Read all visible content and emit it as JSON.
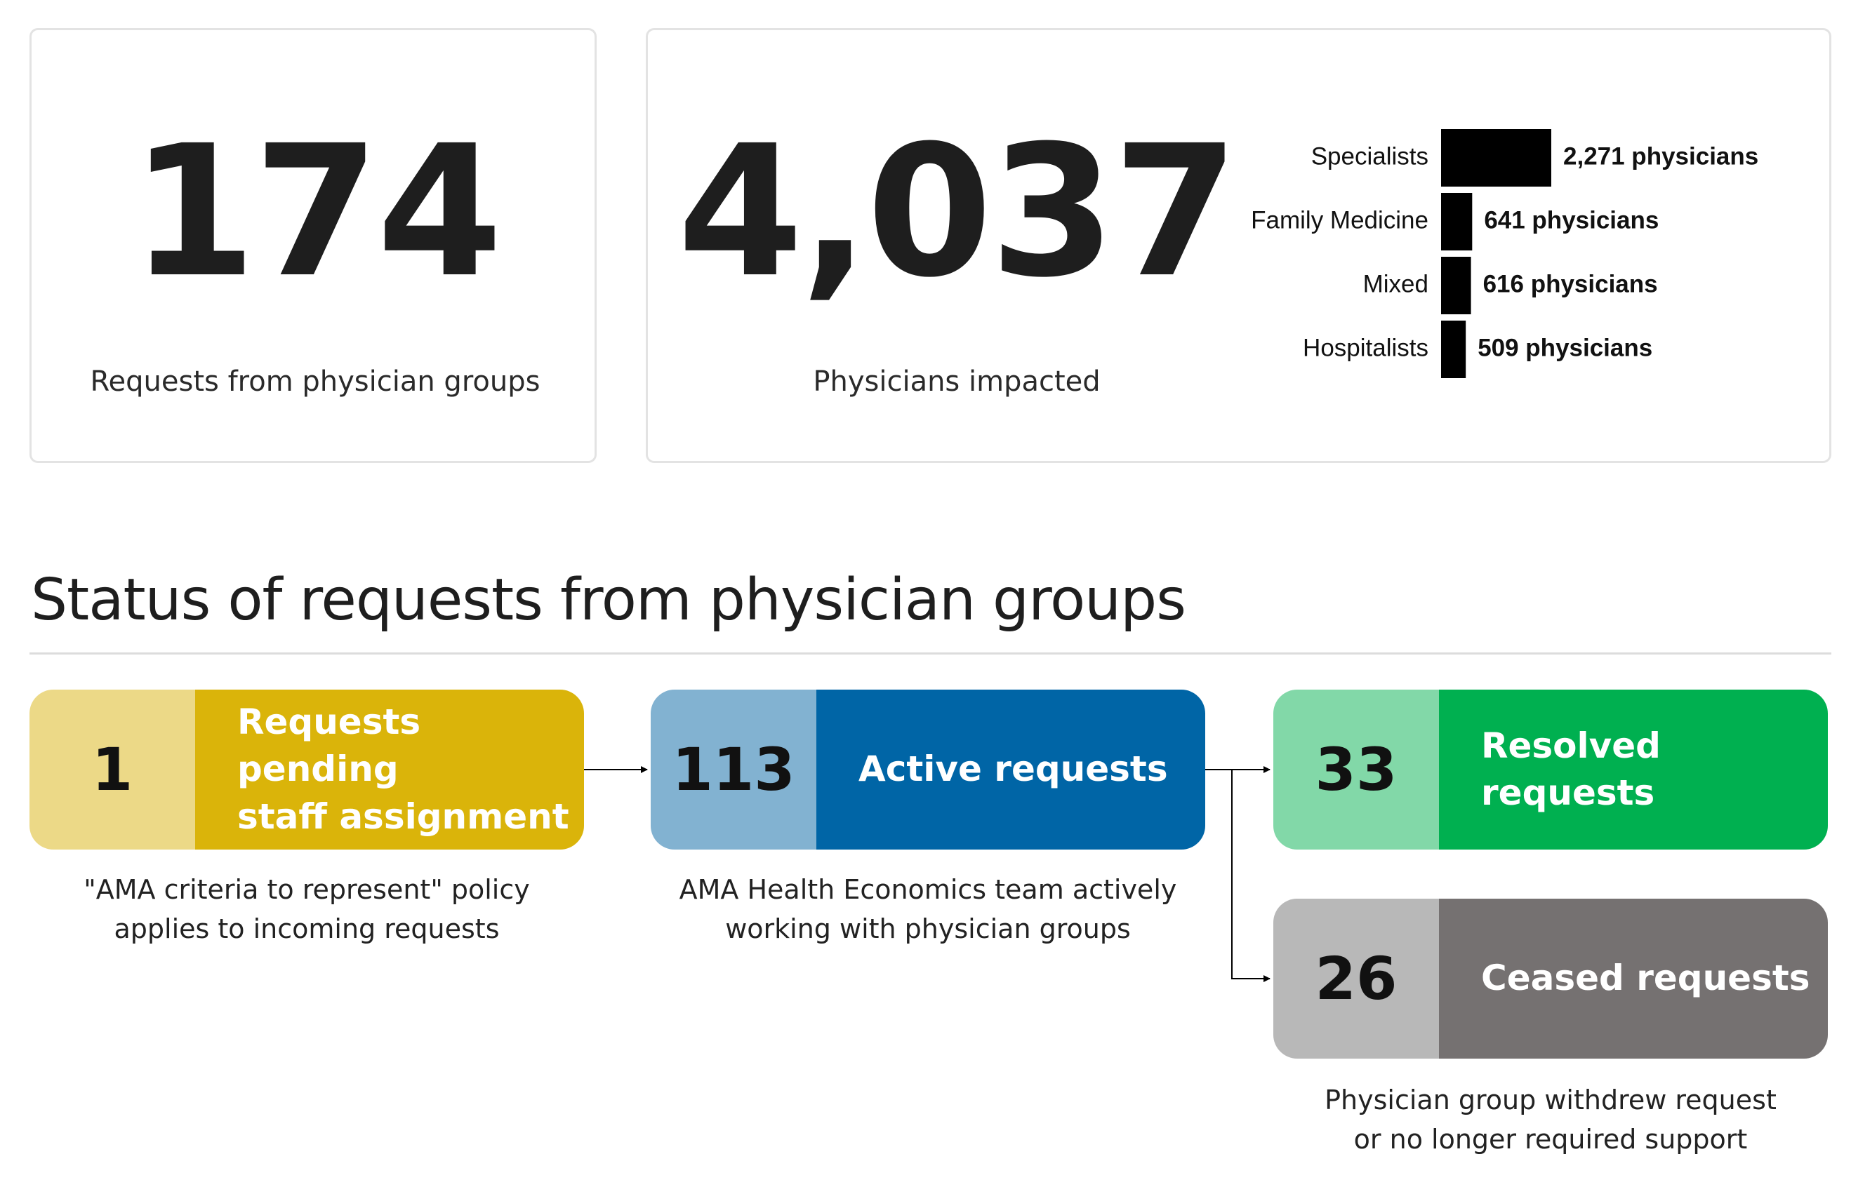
{
  "colors": {
    "text_dark": "#1e1e1e",
    "bar": "#000000",
    "pending_light": "#ecd987",
    "pending_dark": "#dab40a",
    "active_light": "#82b2d1",
    "active_dark": "#0065a6",
    "resolved_light": "#82d8a8",
    "resolved_dark": "#00b050",
    "ceased_light": "#b8b8b8",
    "ceased_dark": "#757171"
  },
  "kpi": {
    "requests": {
      "value": "174",
      "label": "Requests from physician groups"
    },
    "physicians": {
      "value": "4,037",
      "label": "Physicians impacted"
    }
  },
  "chart_data": {
    "type": "bar",
    "orientation": "horizontal",
    "categories": [
      "Specialists",
      "Family Medicine",
      "Mixed",
      "Hospitalists"
    ],
    "values": [
      2271,
      641,
      616,
      509
    ],
    "data_labels": [
      "2,271 physicians",
      "641 physicians",
      "616 physicians",
      "509 physicians"
    ],
    "title": "",
    "xlabel": "",
    "ylabel": "",
    "grid": false,
    "xlim": [
      0,
      2271
    ]
  },
  "section": {
    "title": "Status of requests from physician groups"
  },
  "statuses": {
    "pending": {
      "count": "1",
      "label_line1": "Requests pending",
      "label_line2": "staff assignment",
      "note_line1": "\"AMA criteria to represent\" policy",
      "note_line2": "applies to incoming requests"
    },
    "active": {
      "count": "113",
      "label": "Active requests",
      "note_line1": "AMA Health Economics team actively",
      "note_line2": "working with physician groups"
    },
    "resolved": {
      "count": "33",
      "label": "Resolved requests"
    },
    "ceased": {
      "count": "26",
      "label": "Ceased requests",
      "note_line1": "Physician group withdrew request",
      "note_line2": "or no longer required support"
    }
  }
}
